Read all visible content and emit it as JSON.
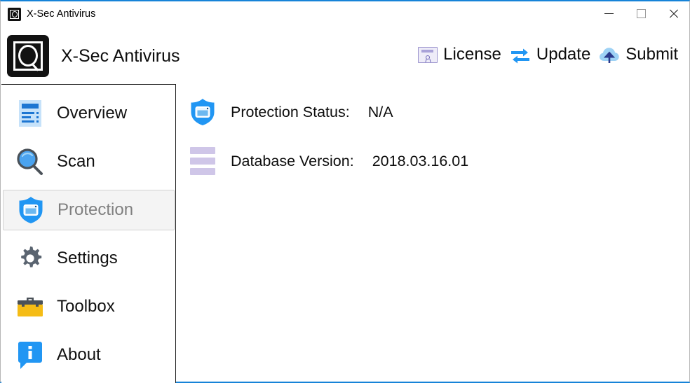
{
  "window": {
    "title": "X-Sec Antivirus",
    "accent_color": "#1683d8",
    "controls": {
      "minimize": "minimize-button",
      "maximize": "maximize-button",
      "close": "close-button"
    }
  },
  "header": {
    "brand_name": "X-Sec Antivirus",
    "actions": [
      {
        "label": "License",
        "icon": "license-certificate-icon"
      },
      {
        "label": "Update",
        "icon": "sync-arrows-icon"
      },
      {
        "label": "Submit",
        "icon": "cloud-upload-icon"
      }
    ]
  },
  "sidebar": {
    "items": [
      {
        "label": "Overview",
        "icon": "document-icon",
        "selected": false
      },
      {
        "label": "Scan",
        "icon": "magnifier-icon",
        "selected": false
      },
      {
        "label": "Protection",
        "icon": "shield-icon",
        "selected": true
      },
      {
        "label": "Settings",
        "icon": "gear-icon",
        "selected": false
      },
      {
        "label": "Toolbox",
        "icon": "toolbox-icon",
        "selected": false
      },
      {
        "label": "About",
        "icon": "info-bubble-icon",
        "selected": false
      }
    ]
  },
  "main": {
    "rows": [
      {
        "icon": "shield-icon",
        "label": "Protection Status:",
        "value": "N/A"
      },
      {
        "icon": "database-icon",
        "label": "Database Version:",
        "value": "2018.03.16.01"
      }
    ]
  },
  "colors": {
    "accent_blue": "#1683d8",
    "icon_blue": "#2196f3",
    "lavender": "#cfc6e8",
    "toolbox_yellow": "#f5bc15",
    "gear_gray": "#5a6470",
    "selected_text": "#808080"
  }
}
